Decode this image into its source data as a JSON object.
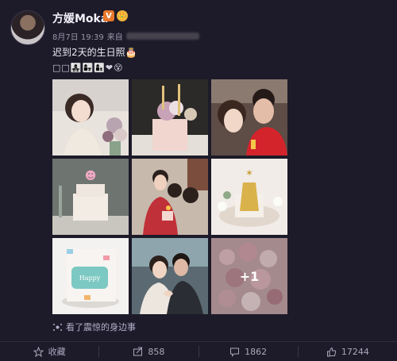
{
  "post": {
    "username": "方媛Moka",
    "date": "8月7日 19:39",
    "source_prefix": "来自",
    "text": "迟到2天的生日照🎂",
    "emojis": "□□👩‍👧‍👧👩‍👧👩‍👦❤😵",
    "more_photos": "+1",
    "source_line": "看了震惊的身边事"
  },
  "actions": {
    "favorite_label": "收藏",
    "repost_count": "858",
    "comment_count": "1862",
    "like_count": "17244"
  },
  "icons": {
    "verified": "V",
    "crown": "👑"
  }
}
